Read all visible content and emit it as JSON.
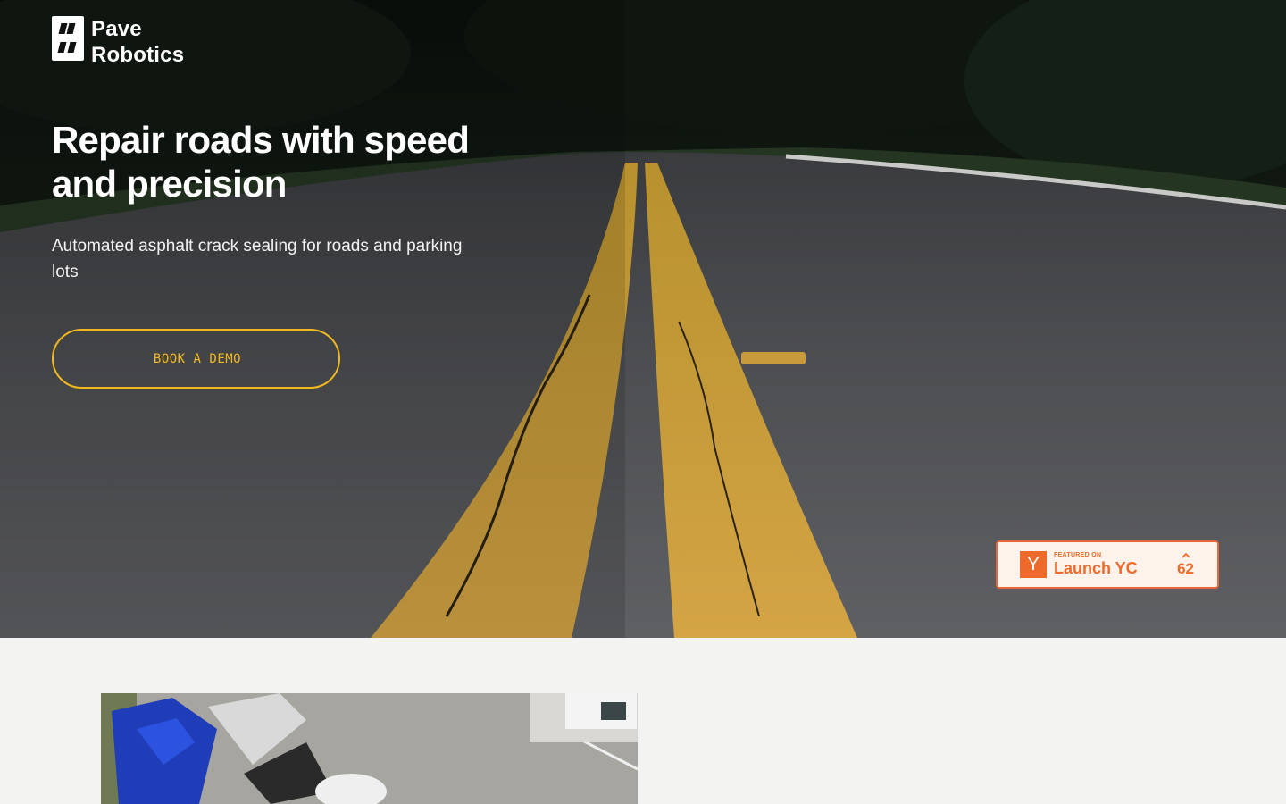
{
  "brand": {
    "name_line1": "Pave",
    "name_line2": "Robotics"
  },
  "hero": {
    "headline": "Repair roads with speed and precision",
    "subheadline": "Automated asphalt crack sealing for roads and parking lots",
    "cta_label": "BOOK A DEMO",
    "accent_color": "#f2b821"
  },
  "yc_badge": {
    "logo_letter": "Y",
    "featured_label": "FEATURED ON",
    "title": "Launch YC",
    "upvote_icon": "chevron-up-icon",
    "vote_count": "62",
    "color": "#ee6a2a"
  },
  "images": {
    "hero_background": "road with double yellow center lines",
    "section_image": "aerial view of trucks in a parking lot"
  }
}
